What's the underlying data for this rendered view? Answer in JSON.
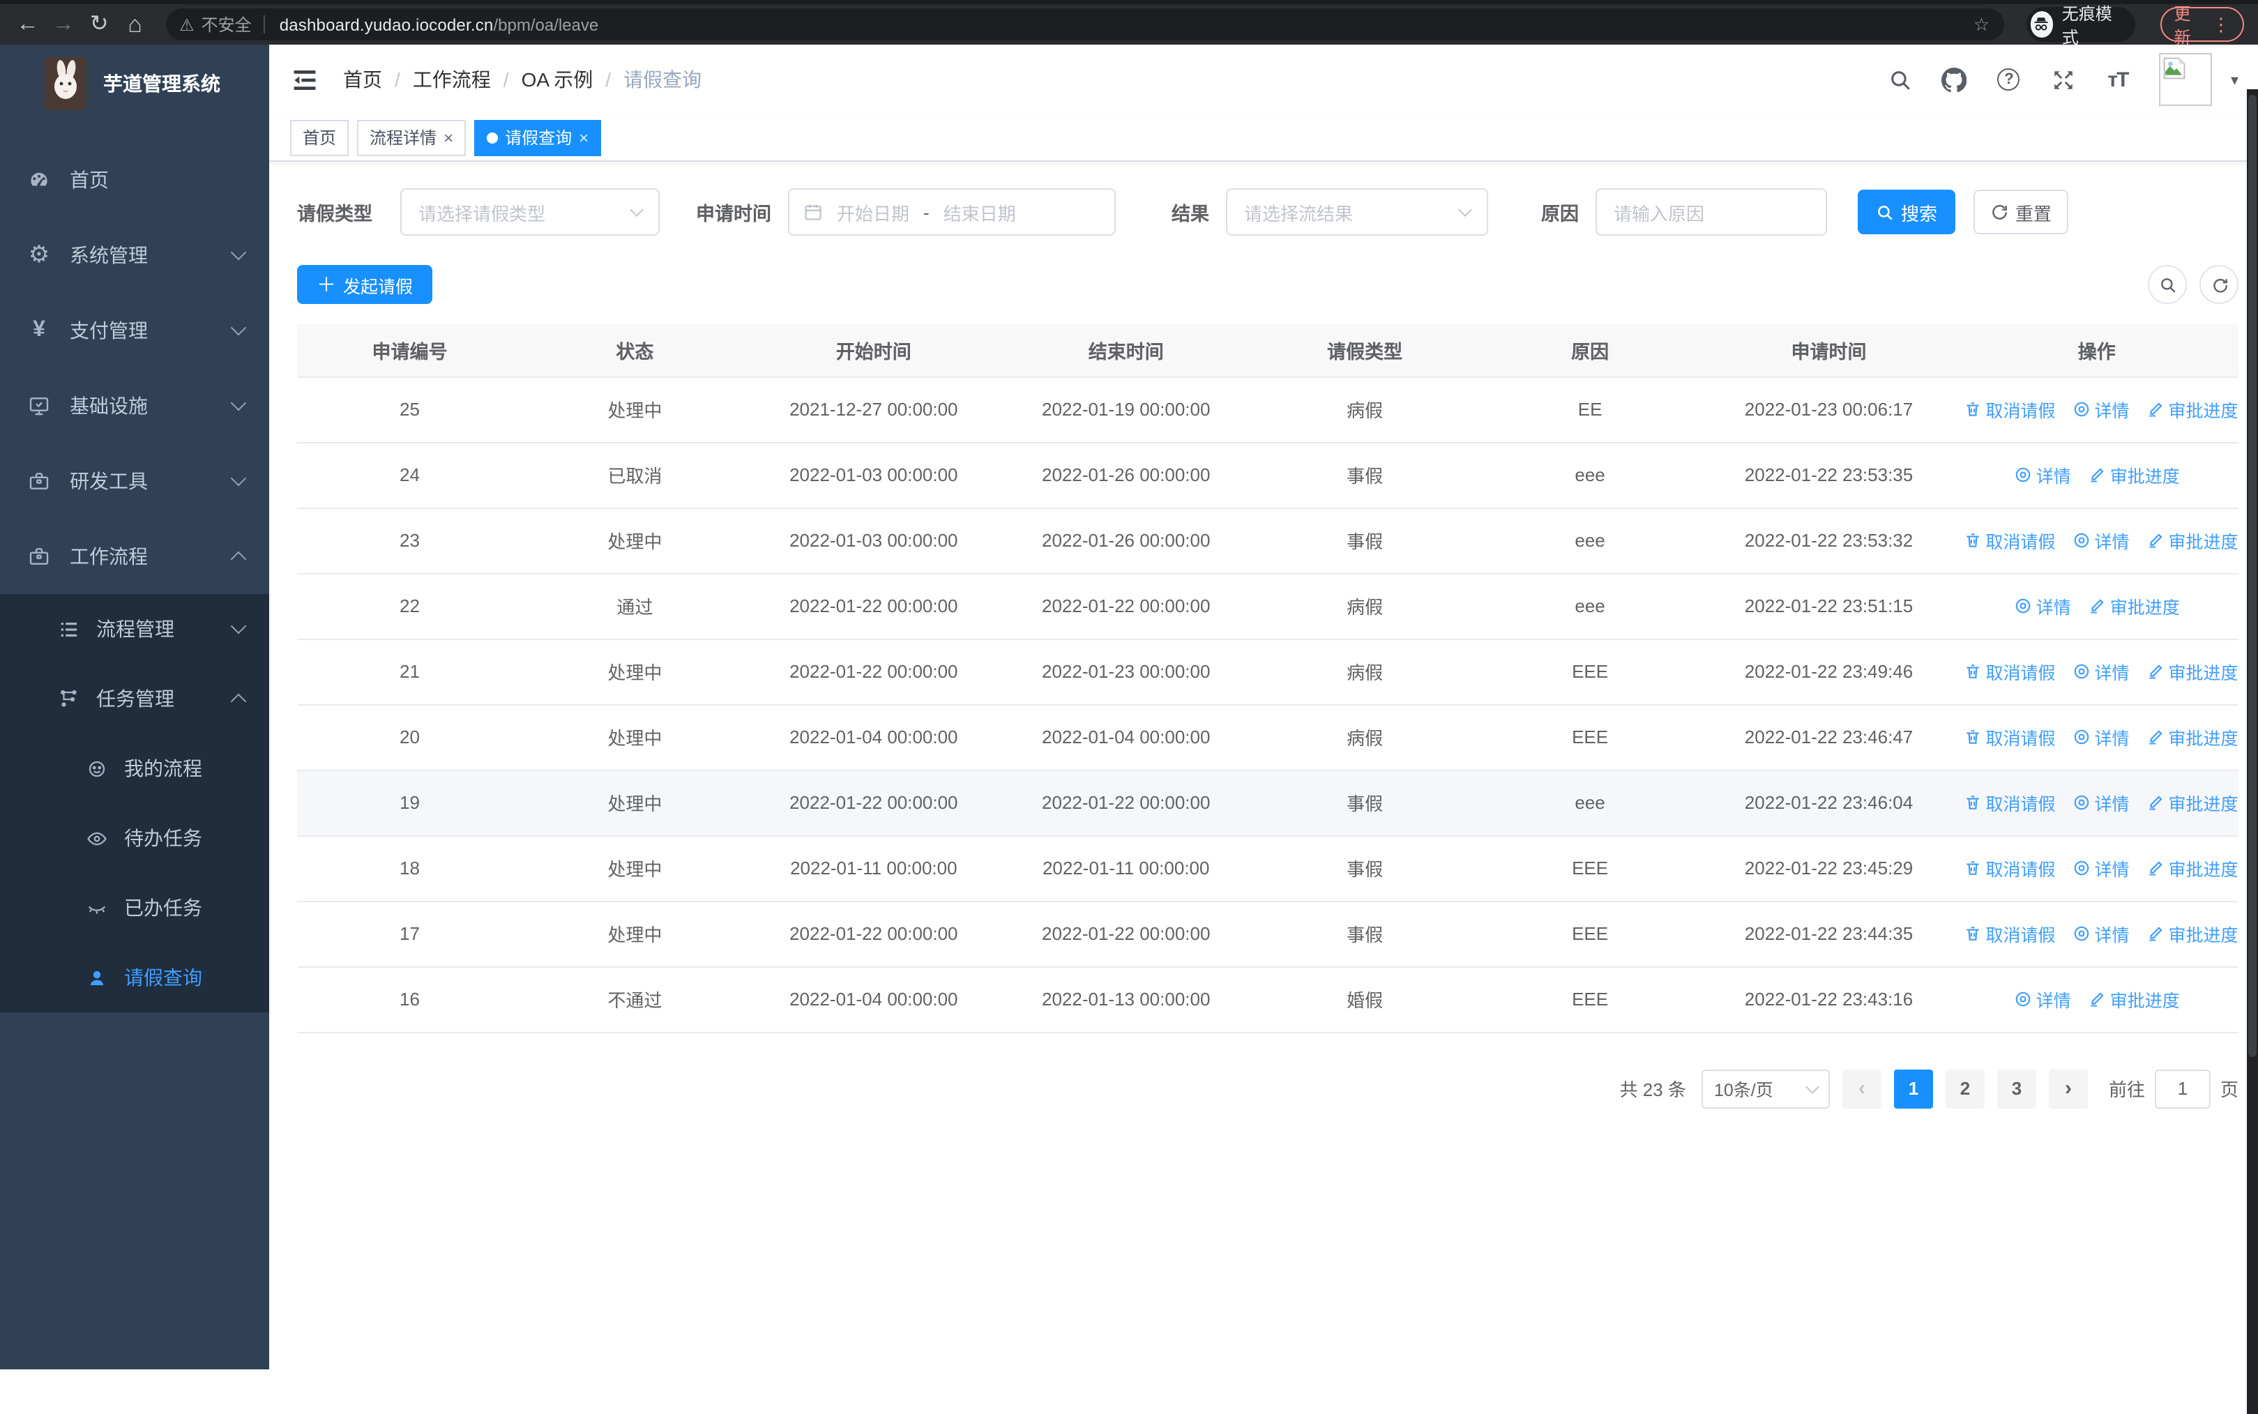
{
  "browser": {
    "security_label": "不安全",
    "url_host": "dashboard.yudao.iocoder.cn",
    "url_path": "/bpm/oa/leave",
    "incognito_label": "无痕模式",
    "update_label": "更新"
  },
  "sidebar": {
    "title": "芋道管理系统",
    "menu": [
      {
        "label": "首页"
      },
      {
        "label": "系统管理"
      },
      {
        "label": "支付管理"
      },
      {
        "label": "基础设施"
      },
      {
        "label": "研发工具"
      },
      {
        "label": "工作流程"
      }
    ],
    "workflow_children": [
      {
        "label": "流程管理"
      },
      {
        "label": "任务管理"
      }
    ],
    "task_children": [
      {
        "label": "我的流程"
      },
      {
        "label": "待办任务"
      },
      {
        "label": "已办任务"
      },
      {
        "label": "请假查询"
      }
    ]
  },
  "breadcrumb": [
    "首页",
    "工作流程",
    "OA 示例",
    "请假查询"
  ],
  "tabs": [
    {
      "label": "首页",
      "closable": false,
      "active": false
    },
    {
      "label": "流程详情",
      "closable": true,
      "active": false
    },
    {
      "label": "请假查询",
      "closable": true,
      "active": true
    }
  ],
  "filters": {
    "type_label": "请假类型",
    "type_placeholder": "请选择请假类型",
    "time_label": "申请时间",
    "time_start_placeholder": "开始日期",
    "time_separator": "-",
    "time_end_placeholder": "结束日期",
    "result_label": "结果",
    "result_placeholder": "请选择流结果",
    "reason_label": "原因",
    "reason_placeholder": "请输入原因",
    "search_label": "搜索",
    "reset_label": "重置"
  },
  "toolbar": {
    "create_label": "发起请假"
  },
  "table": {
    "columns": [
      "申请编号",
      "状态",
      "开始时间",
      "结束时间",
      "请假类型",
      "原因",
      "申请时间",
      "操作"
    ],
    "action_labels": {
      "cancel": "取消请假",
      "detail": "详情",
      "progress": "审批进度"
    },
    "rows": [
      {
        "id": "25",
        "status": "处理中",
        "start": "2021-12-27 00:00:00",
        "end": "2022-01-19 00:00:00",
        "type": "病假",
        "reason": "EE",
        "applied": "2022-01-23 00:06:17",
        "actions": [
          "cancel",
          "detail",
          "progress"
        ],
        "highlight": false
      },
      {
        "id": "24",
        "status": "已取消",
        "start": "2022-01-03 00:00:00",
        "end": "2022-01-26 00:00:00",
        "type": "事假",
        "reason": "eee",
        "applied": "2022-01-22 23:53:35",
        "actions": [
          "detail",
          "progress"
        ],
        "highlight": false
      },
      {
        "id": "23",
        "status": "处理中",
        "start": "2022-01-03 00:00:00",
        "end": "2022-01-26 00:00:00",
        "type": "事假",
        "reason": "eee",
        "applied": "2022-01-22 23:53:32",
        "actions": [
          "cancel",
          "detail",
          "progress"
        ],
        "highlight": false
      },
      {
        "id": "22",
        "status": "通过",
        "start": "2022-01-22 00:00:00",
        "end": "2022-01-22 00:00:00",
        "type": "病假",
        "reason": "eee",
        "applied": "2022-01-22 23:51:15",
        "actions": [
          "detail",
          "progress"
        ],
        "highlight": false
      },
      {
        "id": "21",
        "status": "处理中",
        "start": "2022-01-22 00:00:00",
        "end": "2022-01-23 00:00:00",
        "type": "病假",
        "reason": "EEE",
        "applied": "2022-01-22 23:49:46",
        "actions": [
          "cancel",
          "detail",
          "progress"
        ],
        "highlight": false
      },
      {
        "id": "20",
        "status": "处理中",
        "start": "2022-01-04 00:00:00",
        "end": "2022-01-04 00:00:00",
        "type": "病假",
        "reason": "EEE",
        "applied": "2022-01-22 23:46:47",
        "actions": [
          "cancel",
          "detail",
          "progress"
        ],
        "highlight": false
      },
      {
        "id": "19",
        "status": "处理中",
        "start": "2022-01-22 00:00:00",
        "end": "2022-01-22 00:00:00",
        "type": "事假",
        "reason": "eee",
        "applied": "2022-01-22 23:46:04",
        "actions": [
          "cancel",
          "detail",
          "progress"
        ],
        "highlight": true
      },
      {
        "id": "18",
        "status": "处理中",
        "start": "2022-01-11 00:00:00",
        "end": "2022-01-11 00:00:00",
        "type": "事假",
        "reason": "EEE",
        "applied": "2022-01-22 23:45:29",
        "actions": [
          "cancel",
          "detail",
          "progress"
        ],
        "highlight": false
      },
      {
        "id": "17",
        "status": "处理中",
        "start": "2022-01-22 00:00:00",
        "end": "2022-01-22 00:00:00",
        "type": "事假",
        "reason": "EEE",
        "applied": "2022-01-22 23:44:35",
        "actions": [
          "cancel",
          "detail",
          "progress"
        ],
        "highlight": false
      },
      {
        "id": "16",
        "status": "不通过",
        "start": "2022-01-04 00:00:00",
        "end": "2022-01-13 00:00:00",
        "type": "婚假",
        "reason": "EEE",
        "applied": "2022-01-22 23:43:16",
        "actions": [
          "detail",
          "progress"
        ],
        "highlight": false
      }
    ]
  },
  "pagination": {
    "total_label": "共 23 条",
    "page_size": "10条/页",
    "pages": [
      "1",
      "2",
      "3"
    ],
    "active_page": "1",
    "goto_label": "前往",
    "goto_value": "1",
    "page_unit": "页"
  },
  "colors": {
    "accent": "#1890ff",
    "link": "#409eff",
    "sidebar": "#304156",
    "submenu": "#1f2d3d"
  }
}
